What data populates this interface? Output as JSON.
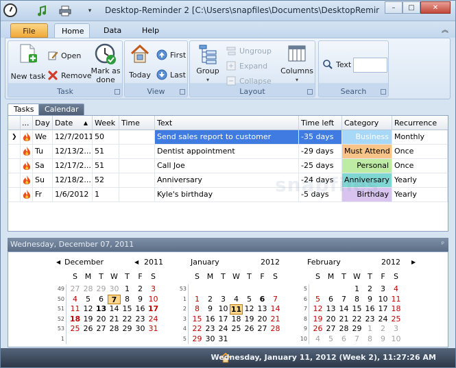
{
  "window": {
    "title": "Desktop-Reminder 2 [C:\\Users\\snapfiles\\Documents\\DesktopReminder\\ta...",
    "controls": {
      "minimize": "–",
      "maximize": "□",
      "close": "✕"
    }
  },
  "ribbon": {
    "tabs": {
      "file": "File",
      "home": "Home",
      "data": "Data",
      "help": "Help"
    },
    "task_group": {
      "label": "Task",
      "new_task": "New task",
      "open": "Open",
      "remove": "Remove",
      "mark_as_done": "Mark as done"
    },
    "view_group": {
      "label": "View",
      "today": "Today",
      "first": "First",
      "last": "Last"
    },
    "layout_group": {
      "label": "Layout",
      "group": "Group",
      "ungroup": "Ungroup",
      "expand": "Expand",
      "collapse": "Collapse",
      "columns": "Columns"
    },
    "search_group": {
      "label": "Search",
      "text_label": "Text",
      "text_value": ""
    }
  },
  "doc_tabs": {
    "tasks": "Tasks",
    "calendar": "Calendar"
  },
  "grid": {
    "headers": {
      "indicator": "...",
      "day": "Day",
      "date": "Date",
      "sort_arrow": "▲",
      "week": "Week",
      "time": "Time",
      "text": "Text",
      "time_left": "Time left",
      "category": "Category",
      "recurrence": "Recurrence"
    },
    "rows": [
      {
        "day": "We",
        "date": "12/7/2011",
        "week": "50",
        "time": "",
        "text": "Send sales report to customer",
        "time_left": "-35 days",
        "category": "Business",
        "category_color": "#a8d8f8",
        "recurrence": "Monthly"
      },
      {
        "day": "Tu",
        "date": "12/13/2...",
        "week": "51",
        "time": "",
        "text": "Dentist appointment",
        "time_left": "-29 days",
        "category": "Must Attend",
        "category_color": "#f7c48a",
        "recurrence": "Once"
      },
      {
        "day": "Sa",
        "date": "12/17/2...",
        "week": "51",
        "time": "",
        "text": "Call Joe",
        "time_left": "-25 days",
        "category": "Personal",
        "category_color": "#bfeca4",
        "recurrence": "Once"
      },
      {
        "day": "Su",
        "date": "12/18/2...",
        "week": "52",
        "time": "",
        "text": "Anniversary",
        "time_left": "-24 days",
        "category": "Anniversary",
        "category_color": "#7fd6d2",
        "recurrence": "Yearly"
      },
      {
        "day": "Fr",
        "date": "1/6/2012",
        "week": "1",
        "time": "",
        "text": "Kyle's birthday",
        "time_left": "-5 days",
        "category": "Birthday",
        "category_color": "#d8c4ee",
        "recurrence": "Yearly"
      }
    ],
    "row_marker": "❯"
  },
  "calendar": {
    "header": "Wednesday, December 07, 2011",
    "pin": "ᵖ",
    "day_names": [
      "S",
      "M",
      "T",
      "W",
      "T",
      "F",
      "S"
    ],
    "months": [
      {
        "name": "December",
        "year": "2011",
        "prev": "◀",
        "next": "◀",
        "weeks": [
          "49",
          "50",
          "51",
          "52",
          "53",
          "1"
        ],
        "days": [
          [
            "27",
            "28",
            "29",
            "30",
            "1",
            "2",
            "3"
          ],
          [
            "4",
            "5",
            "6",
            "7",
            "8",
            "9",
            "10"
          ],
          [
            "11",
            "12",
            "13",
            "14",
            "15",
            "16",
            "17"
          ],
          [
            "18",
            "19",
            "20",
            "21",
            "22",
            "23",
            "24"
          ],
          [
            "25",
            "26",
            "27",
            "28",
            "29",
            "30",
            "31"
          ],
          [
            "",
            "",
            "",
            "",
            "",
            "",
            ""
          ]
        ]
      },
      {
        "name": "January",
        "year": "2012",
        "weeks": [
          "53",
          "1",
          "2",
          "3",
          "4",
          "5"
        ],
        "days": [
          [
            "",
            "",
            "",
            "",
            "",
            "",
            ""
          ],
          [
            "1",
            "2",
            "3",
            "4",
            "5",
            "6",
            "7"
          ],
          [
            "8",
            "9",
            "10",
            "11",
            "12",
            "13",
            "14"
          ],
          [
            "15",
            "16",
            "17",
            "18",
            "19",
            "20",
            "21"
          ],
          [
            "22",
            "23",
            "24",
            "25",
            "26",
            "27",
            "28"
          ],
          [
            "29",
            "30",
            "31",
            "",
            "",
            "",
            ""
          ]
        ]
      },
      {
        "name": "February",
        "year": "2012",
        "next": "▶",
        "weeks": [
          "5",
          "6",
          "7",
          "8",
          "9",
          "10"
        ],
        "days": [
          [
            "",
            "",
            "",
            "1",
            "2",
            "3",
            "4"
          ],
          [
            "5",
            "6",
            "7",
            "8",
            "9",
            "10",
            "11"
          ],
          [
            "12",
            "13",
            "14",
            "15",
            "16",
            "17",
            "18"
          ],
          [
            "19",
            "20",
            "21",
            "22",
            "23",
            "24",
            "25"
          ],
          [
            "26",
            "27",
            "28",
            "29",
            "1",
            "2",
            "3"
          ],
          [
            "4",
            "5",
            "6",
            "7",
            "8",
            "9",
            "10"
          ]
        ]
      }
    ]
  },
  "status": {
    "text": "Wednesday, January 11, 2012 (Week 2), 11:27:26 AM"
  },
  "watermark": "snapfiles"
}
